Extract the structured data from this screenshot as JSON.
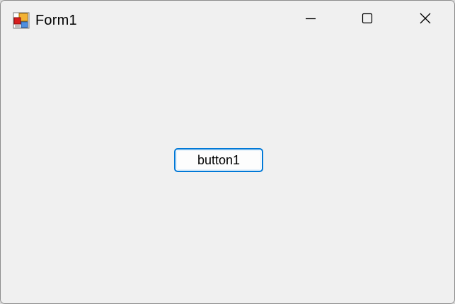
{
  "window": {
    "title": "Form1",
    "icon": "winforms-app-icon",
    "caption_buttons": {
      "minimize_icon": "minimize-icon",
      "maximize_icon": "maximize-icon",
      "close_icon": "close-icon"
    }
  },
  "form": {
    "button1_label": "button1"
  },
  "colors": {
    "window_background": "#f0f0f0",
    "focus_border": "#0078d7"
  }
}
